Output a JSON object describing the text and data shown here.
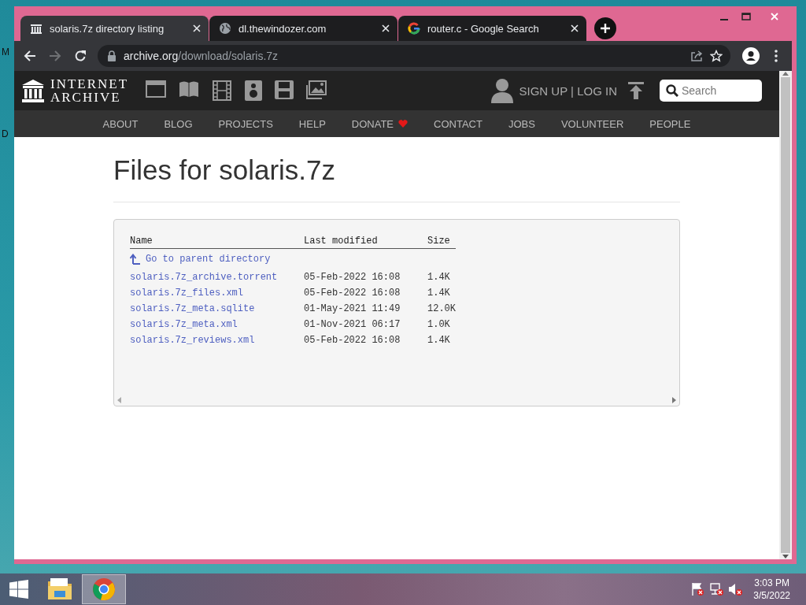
{
  "desktop": {
    "icon_labels": [
      "M",
      "D"
    ]
  },
  "browser": {
    "tabs": [
      {
        "title": "solaris.7z directory listing",
        "kind": "archive",
        "selected": true
      },
      {
        "title": "dl.thewindozer.com",
        "kind": "globe",
        "selected": false
      },
      {
        "title": "router.c - Google Search",
        "kind": "google",
        "selected": false
      }
    ],
    "toolbar": {
      "forward_disabled": true,
      "url_host": "archive.org",
      "url_path": "/download/solaris.7z"
    }
  },
  "site_header": {
    "logo_line_1": "INTERNET",
    "logo_line_2": "ARCHIVE",
    "account_link": "SIGN UP | LOG IN",
    "search": {
      "placeholder": "Search"
    },
    "nav": [
      {
        "label": "ABOUT",
        "kind": "plain"
      },
      {
        "label": "BLOG",
        "kind": "plain"
      },
      {
        "label": "PROJECTS",
        "kind": "plain"
      },
      {
        "label": "HELP",
        "kind": "plain"
      },
      {
        "label": "DONATE",
        "kind": "donate"
      },
      {
        "label": "CONTACT",
        "kind": "plain"
      },
      {
        "label": "JOBS",
        "kind": "plain"
      },
      {
        "label": "VOLUNTEER",
        "kind": "plain"
      },
      {
        "label": "PEOPLE",
        "kind": "plain"
      }
    ]
  },
  "page": {
    "title": "Files for solaris.7z",
    "listing": {
      "columns": [
        "Name",
        "Last modified",
        "Size"
      ],
      "parent_link": "Go to parent directory",
      "rows": [
        {
          "name": "solaris.7z_archive.torrent",
          "modified": "05-Feb-2022 16:08",
          "size": "1.4K"
        },
        {
          "name": "solaris.7z_files.xml",
          "modified": "05-Feb-2022 16:08",
          "size": "1.4K"
        },
        {
          "name": "solaris.7z_meta.sqlite",
          "modified": "01-May-2021 11:49",
          "size": "12.0K"
        },
        {
          "name": "solaris.7z_meta.xml",
          "modified": "01-Nov-2021 06:17",
          "size": "1.0K"
        },
        {
          "name": "solaris.7z_reviews.xml",
          "modified": "05-Feb-2022 16:08",
          "size": "1.4K"
        }
      ]
    }
  },
  "taskbar": {
    "apps": [
      {
        "kind": "explorer",
        "selected": false
      },
      {
        "kind": "chrome",
        "selected": true
      }
    ],
    "time": "3:03 PM",
    "date": "3/5/2022"
  }
}
